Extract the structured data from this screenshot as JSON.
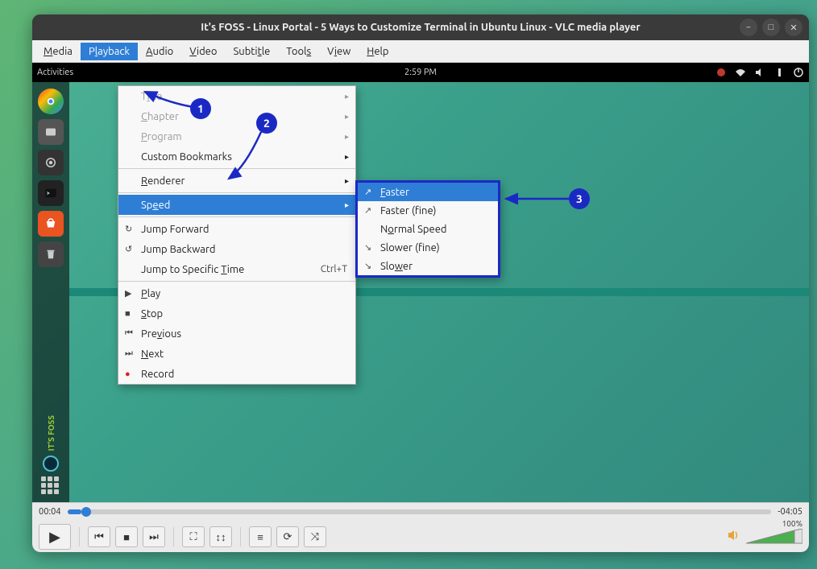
{
  "title": "It's FOSS - Linux Portal - 5 Ways to Customize Terminal in Ubuntu Linux - VLC media player",
  "menubar": [
    "Media",
    "Playback",
    "Audio",
    "Video",
    "Subtitle",
    "Tools",
    "View",
    "Help"
  ],
  "topbar": {
    "left": "Activities",
    "center": "2:59 PM"
  },
  "dock": {
    "foss_label": "IT'S FOSS"
  },
  "dropdown": {
    "title": "Title",
    "chapter": "Chapter",
    "program": "Program",
    "bookmarks": "Custom Bookmarks",
    "renderer": "Renderer",
    "speed": "Speed",
    "jumpf": "Jump Forward",
    "jumpb": "Jump Backward",
    "jumpt": "Jump to Specific Time",
    "jumpt_shortcut": "Ctrl+T",
    "play": "Play",
    "stop": "Stop",
    "previous": "Previous",
    "next": "Next",
    "record": "Record"
  },
  "submenu": {
    "faster": "Faster",
    "faster_fine": "Faster (fine)",
    "normal": "Normal Speed",
    "slower_fine": "Slower (fine)",
    "slower": "Slower"
  },
  "callouts": {
    "one": "1",
    "two": "2",
    "three": "3"
  },
  "time": {
    "elapsed": "00:04",
    "remaining": "-04:05"
  },
  "volume": {
    "pct": "100%"
  }
}
